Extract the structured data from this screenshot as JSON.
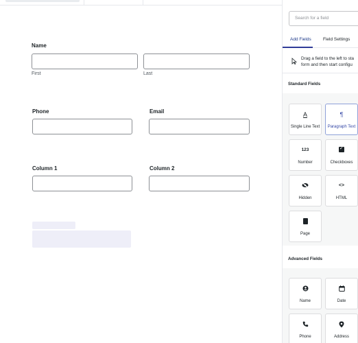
{
  "form": {
    "name": {
      "label": "Name",
      "first_sub": "First",
      "last_sub": "Last"
    },
    "phone": {
      "label": "Phone"
    },
    "email": {
      "label": "Email"
    },
    "column1": {
      "label": "Column 1"
    },
    "column2": {
      "label": "Column 2"
    }
  },
  "sidebar": {
    "search_placeholder": "Search for a field",
    "tabs": [
      {
        "label": "Add Fields",
        "active": true
      },
      {
        "label": "Field Settings",
        "active": false
      }
    ],
    "hint_line1": "Drag a field to the left to sta",
    "hint_line2": "form and then start configu",
    "standard_title": "Standard Fields",
    "standard_fields": [
      {
        "label": "Single Line Text",
        "icon": "text-a-icon",
        "glyph": "A"
      },
      {
        "label": "Paragraph Text",
        "icon": "paragraph-icon",
        "glyph": "¶"
      },
      {
        "label": "Number",
        "icon": "number-icon",
        "glyph": "123"
      },
      {
        "label": "Checkboxes",
        "icon": "checkbox-icon",
        "glyph": ""
      },
      {
        "label": "Hidden",
        "icon": "eye-off-icon",
        "glyph": ""
      },
      {
        "label": "HTML",
        "icon": "code-icon",
        "glyph": "<>"
      },
      {
        "label": "Page",
        "icon": "page-icon",
        "glyph": ""
      }
    ],
    "advanced_title": "Advanced Fields",
    "advanced_fields": [
      {
        "label": "Name",
        "icon": "user-icon",
        "glyph": ""
      },
      {
        "label": "Date",
        "icon": "calendar-icon",
        "glyph": ""
      },
      {
        "label": "Phone",
        "icon": "phone-icon",
        "glyph": ""
      },
      {
        "label": "Address",
        "icon": "map-pin-icon",
        "glyph": ""
      }
    ],
    "accent_color": "#3447a6"
  }
}
